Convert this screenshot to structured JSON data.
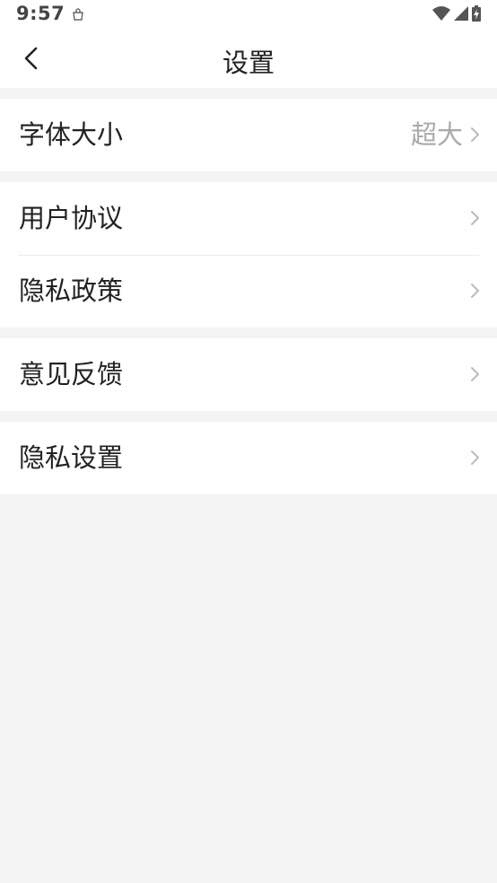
{
  "status_bar": {
    "time": "9:57",
    "icons": [
      "notification-bag-icon",
      "wifi-icon",
      "cellular-signal-icon",
      "battery-charging-icon"
    ]
  },
  "nav_bar": {
    "title": "设置",
    "back_icon": "chevron-left-icon"
  },
  "settings": {
    "font_size": {
      "label": "字体大小",
      "value": "超大"
    },
    "user_agreement": {
      "label": "用户协议"
    },
    "privacy_policy": {
      "label": "隐私政策"
    },
    "feedback": {
      "label": "意见反馈"
    },
    "privacy_settings": {
      "label": "隐私设置"
    }
  },
  "colors": {
    "background": "#f4f4f4",
    "surface": "#ffffff",
    "text_primary": "#222222",
    "text_secondary": "#aaaaaa",
    "chevron": "#bbbbbb"
  }
}
